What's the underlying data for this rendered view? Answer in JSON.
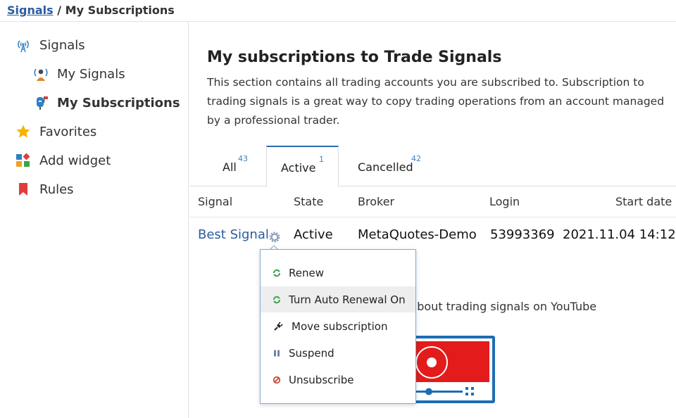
{
  "breadcrumb": {
    "root": "Signals",
    "separator": " / ",
    "current": "My Subscriptions"
  },
  "sidebar": {
    "items": [
      {
        "label": "Signals",
        "icon": "antenna-icon"
      },
      {
        "label": "My Signals",
        "icon": "broadcast-user-icon"
      },
      {
        "label": "My Subscriptions",
        "icon": "mailbox-icon"
      },
      {
        "label": "Favorites",
        "icon": "star-icon"
      },
      {
        "label": "Add widget",
        "icon": "widget-icon"
      },
      {
        "label": "Rules",
        "icon": "bookmark-icon"
      }
    ]
  },
  "main": {
    "title": "My subscriptions to Trade Signals",
    "description": "This section contains all trading accounts you are subscribed to. Subscription to trading signals is a great way to copy trading operations from an account managed by a professional trader.",
    "tabs": [
      {
        "label": "All",
        "count": "43"
      },
      {
        "label": "Active",
        "count": "1"
      },
      {
        "label": "Cancelled",
        "count": "42"
      }
    ],
    "table": {
      "columns": [
        "Signal",
        "State",
        "Broker",
        "Login",
        "Start date"
      ],
      "row": {
        "signal": "Best Signal",
        "state": "Active",
        "broker": "MetaQuotes-Demo",
        "login": "53993369",
        "start_date": "2021.11.04 14:12"
      }
    },
    "youtube_text": "s about trading signals on YouTube"
  },
  "menu": {
    "items": [
      {
        "label": "Renew",
        "icon": "renew-icon"
      },
      {
        "label": "Turn Auto Renewal On",
        "icon": "auto-renew-icon"
      },
      {
        "label": "Move subscription",
        "icon": "plug-icon"
      },
      {
        "label": "Suspend",
        "icon": "pause-icon"
      },
      {
        "label": "Unsubscribe",
        "icon": "unsubscribe-icon"
      }
    ]
  },
  "colors": {
    "link": "#2b5c9e",
    "accent": "#1e6db3",
    "count": "#3b82c4",
    "red": "#e31b1b",
    "green": "#3aa64a"
  }
}
